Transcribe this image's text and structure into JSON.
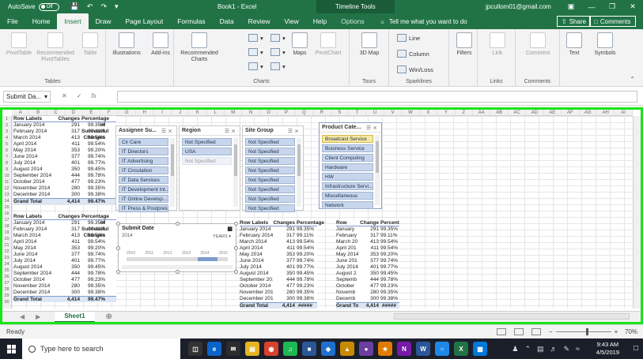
{
  "titlebar": {
    "autosave_label": "AutoSave",
    "autosave_state": "Off",
    "doc_title": "Book1 - Excel",
    "context_tab": "Timeline Tools",
    "user": "jpcullom01@gmail.com"
  },
  "tabs": [
    "File",
    "Home",
    "Insert",
    "Draw",
    "Page Layout",
    "Formulas",
    "Data",
    "Review",
    "View",
    "Help",
    "Options"
  ],
  "active_tab": "Insert",
  "tell_me": "Tell me what you want to do",
  "share_label": "Share",
  "comments_label": "Comments",
  "ribbon": {
    "tables": {
      "label": "Tables",
      "pivot": "PivotTable",
      "rec_pivot": "Recommended PivotTables",
      "table": "Table"
    },
    "illustrations": "Illustrations",
    "addins": "Add-ins",
    "charts": {
      "label": "Charts",
      "rec": "Recommended Charts",
      "maps": "Maps",
      "pivotchart": "PivotChart"
    },
    "tours": {
      "label": "Tours",
      "map3d": "3D Map"
    },
    "sparklines": {
      "label": "Sparklines",
      "line": "Line",
      "column": "Column",
      "winloss": "Win/Loss"
    },
    "filters": {
      "label": "",
      "btn": "Filters"
    },
    "links": {
      "label": "Links",
      "btn": "Link"
    },
    "comments": {
      "label": "Comments",
      "btn": "Comment"
    },
    "text": "Text",
    "symbols": "Symbols"
  },
  "formula_bar": {
    "name_box": "Submit Da...",
    "value": ""
  },
  "columns": [
    "A",
    "B",
    "C",
    "D",
    "E",
    "F",
    "G",
    "H",
    "I",
    "J",
    "K",
    "L",
    "M",
    "N",
    "O",
    "P",
    "Q",
    "R",
    "S",
    "T",
    "U",
    "V",
    "W",
    "X",
    "Y",
    "Z",
    "AA",
    "AB",
    "AC",
    "AD",
    "AE",
    "AF",
    "AG",
    "AH",
    "AI"
  ],
  "rows": [
    "1",
    "2",
    "3",
    "4",
    "5",
    "6",
    "7",
    "8",
    "9",
    "10",
    "11",
    "12",
    "13",
    "14",
    "15",
    "16",
    "17",
    "18",
    "19",
    "20",
    "21",
    "22",
    "23",
    "24",
    "25",
    "26",
    "27",
    "28",
    "29",
    "30"
  ],
  "pivot1": {
    "headers": [
      "Row Labels",
      "Changes",
      "Percentage of Successful Changes"
    ],
    "rows": [
      [
        "January 2014",
        "291",
        "99.35%"
      ],
      [
        "February 2014",
        "317",
        "99.11%"
      ],
      [
        "March 2014",
        "413",
        "99.54%"
      ],
      [
        "April 2014",
        "411",
        "99.54%"
      ],
      [
        "May 2014",
        "353",
        "99.20%"
      ],
      [
        "June 2014",
        "377",
        "99.74%"
      ],
      [
        "July 2014",
        "401",
        "99.77%"
      ],
      [
        "August 2014",
        "350",
        "99.45%"
      ],
      [
        "September 2014",
        "444",
        "99.78%"
      ],
      [
        "October 2014",
        "477",
        "99.23%"
      ],
      [
        "November 2014",
        "280",
        "99.35%"
      ],
      [
        "December 2014",
        "300",
        "99.38%"
      ]
    ],
    "total": [
      "Grand Total",
      "4,414",
      "99.47%"
    ]
  },
  "pivot2": {
    "headers": [
      "Row Labels",
      "Changes",
      "Percentage of Successful Changes"
    ],
    "rows": [
      [
        "January 2014",
        "291",
        "99.35%"
      ],
      [
        "February 2014",
        "317",
        "99.11%"
      ],
      [
        "March 2014",
        "413",
        "99.54%"
      ],
      [
        "April 2014",
        "411",
        "99.54%"
      ],
      [
        "May 2014",
        "353",
        "99.20%"
      ],
      [
        "June 2014",
        "377",
        "99.74%"
      ],
      [
        "July 2014",
        "401",
        "99.77%"
      ],
      [
        "August 2014",
        "350",
        "99.45%"
      ],
      [
        "September 2014",
        "444",
        "99.78%"
      ],
      [
        "October 2014",
        "477",
        "99.23%"
      ],
      [
        "November 2014",
        "280",
        "99.35%"
      ],
      [
        "December 2014",
        "300",
        "99.38%"
      ]
    ],
    "total": [
      "Grand Total",
      "4,414",
      "99.47%"
    ]
  },
  "pivot3": {
    "headers": [
      "Row Labels",
      "Changes",
      "Percentage"
    ],
    "rows": [
      [
        "January 2014",
        "291",
        "99.35%"
      ],
      [
        "February 2014",
        "317",
        "99.11%"
      ],
      [
        "March 2014",
        "413",
        "99.54%"
      ],
      [
        "April 2014",
        "411",
        "99.54%"
      ],
      [
        "May 2014",
        "353",
        "99.20%"
      ],
      [
        "June 2014",
        "377",
        "99.74%"
      ],
      [
        "July 2014",
        "401",
        "99.77%"
      ],
      [
        "August 2014",
        "350",
        "99.45%"
      ],
      [
        "September 2014",
        "444",
        "99.78%"
      ],
      [
        "October 2014",
        "477",
        "99.23%"
      ],
      [
        "November 2014",
        "280",
        "99.35%"
      ],
      [
        "December 2014",
        "300",
        "99.38%"
      ]
    ],
    "total": [
      "Grand Total",
      "4,414",
      "#####"
    ]
  },
  "pivot4": {
    "headers": [
      "Row",
      "Change",
      "Percent"
    ],
    "rows": [
      [
        "January",
        "291",
        "99.35%"
      ],
      [
        "February",
        "317",
        "99.11%"
      ],
      [
        "March 20",
        "413",
        "99.54%"
      ],
      [
        "April 201",
        "411",
        "99.54%"
      ],
      [
        "May 2014",
        "353",
        "99.20%"
      ],
      [
        "June 201",
        "377",
        "99.74%"
      ],
      [
        "July 2014",
        "401",
        "99.77%"
      ],
      [
        "August 2",
        "350",
        "99.45%"
      ],
      [
        "Septemb",
        "444",
        "99.78%"
      ],
      [
        "October",
        "477",
        "99.23%"
      ],
      [
        "Novemb",
        "280",
        "99.35%"
      ],
      [
        "Decemb",
        "300",
        "99.38%"
      ]
    ],
    "total": [
      "Grand Tot",
      "4,414",
      "#####"
    ]
  },
  "slicers": {
    "assignee": {
      "title": "Assignee Su...",
      "items": [
        "Cir Care",
        "IT Directors",
        "IT Advertising",
        "IT Circulation",
        "IT Data Services",
        "IT Development Int...",
        "IT Online Develop...",
        "IT Press & Postpress"
      ]
    },
    "region": {
      "title": "Region",
      "items": [
        "Not Specified",
        "USA",
        "Not Specified"
      ]
    },
    "site": {
      "title": "Site Group",
      "items": [
        "Not Specified",
        "Not Specified",
        "Not Specified",
        "Not Specified",
        "Not Specified",
        "Not Specified",
        "Not Specified",
        "Not Specified"
      ]
    },
    "product": {
      "title": "Product Cate...",
      "items": [
        "Broadcast Service",
        "Business Service",
        "Client Computing",
        "Hardware",
        "HW",
        "Infrastructure Servi...",
        "Miscellaneous",
        "Network"
      ]
    }
  },
  "timeline": {
    "title": "Submit Date",
    "year": "2014",
    "level": "YEARS",
    "years": [
      "2010",
      "2011",
      "2012",
      "2013",
      "2014",
      "2015"
    ]
  },
  "sheet_tab": "Sheet1",
  "status": {
    "ready": "Ready",
    "zoom": "70%"
  },
  "taskbar": {
    "search_placeholder": "Type here to search",
    "time": "9:43 AM",
    "date": "4/5/2019"
  }
}
